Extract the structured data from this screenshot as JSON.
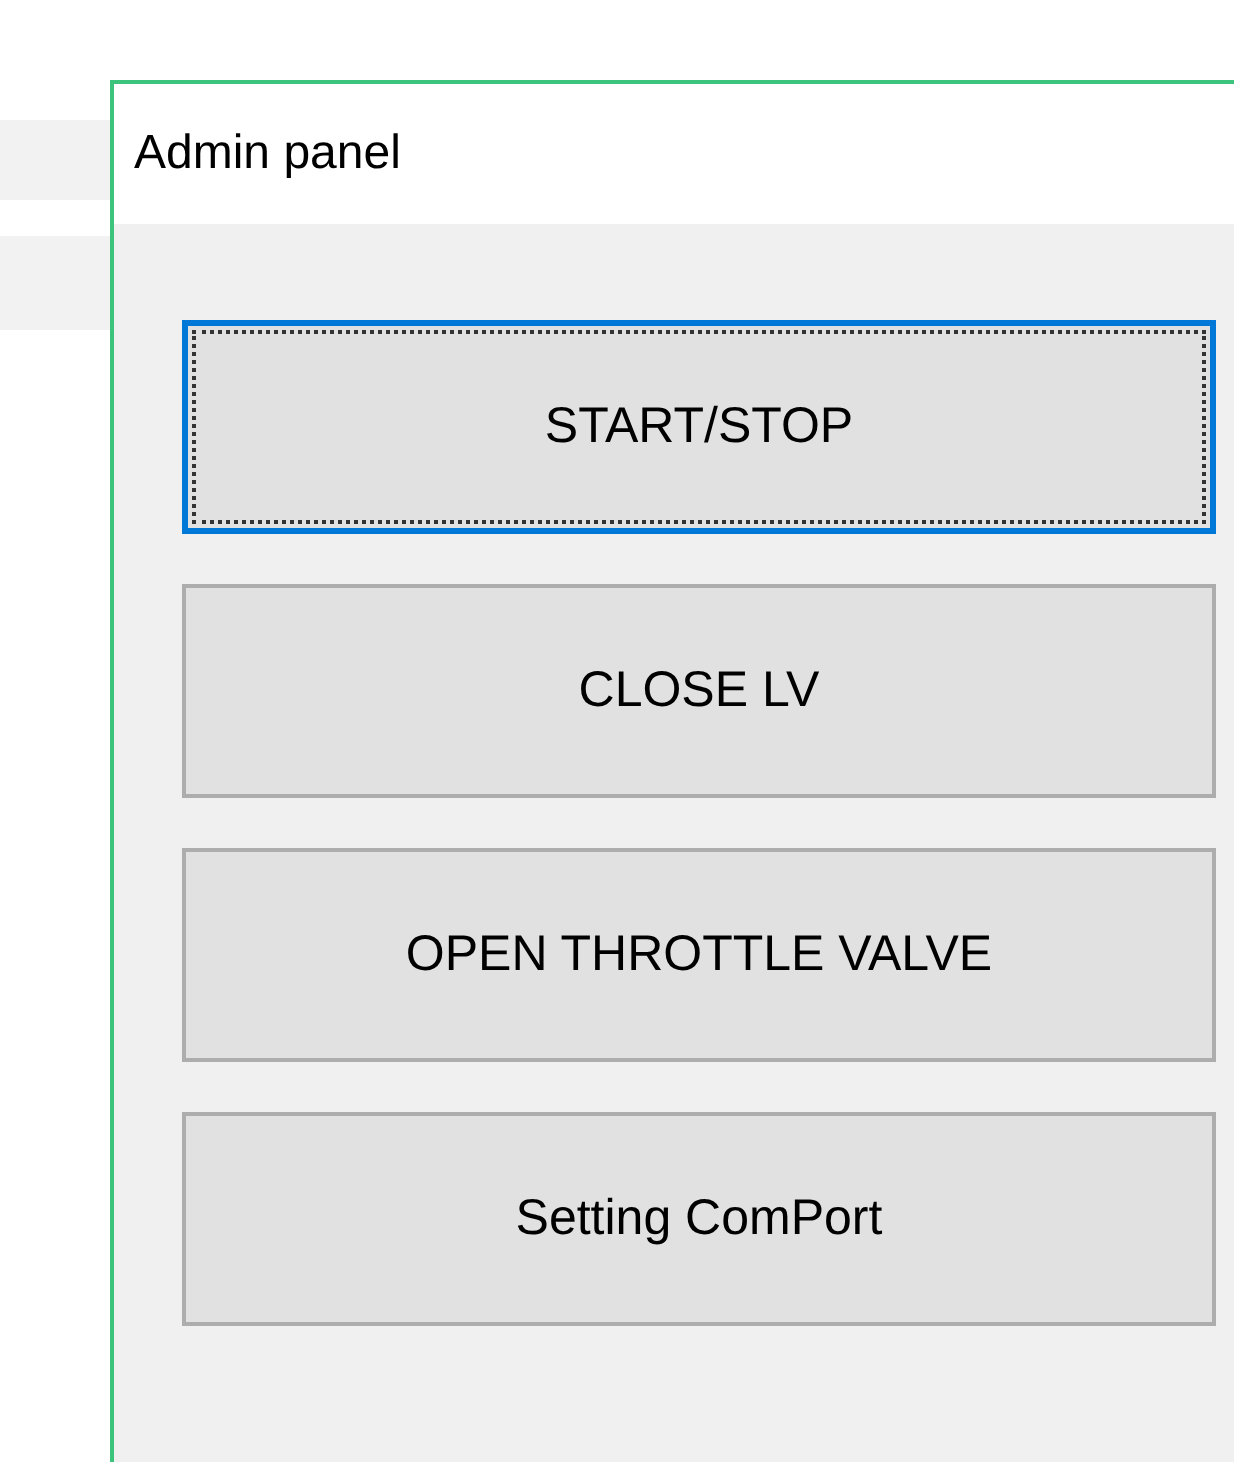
{
  "window": {
    "title": "Admin panel"
  },
  "buttons": [
    {
      "label": "START/STOP",
      "focused": true
    },
    {
      "label": "CLOSE LV",
      "focused": false
    },
    {
      "label": "OPEN THROTTLE VALVE",
      "focused": false
    },
    {
      "label": "Setting ComPort",
      "focused": false
    }
  ]
}
